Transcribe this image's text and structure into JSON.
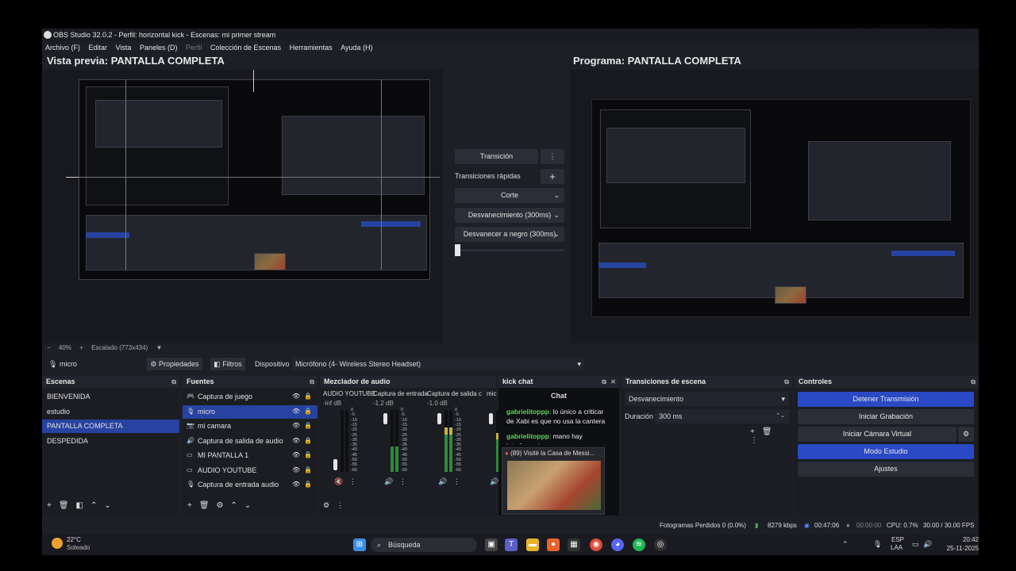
{
  "window": {
    "title": "OBS Studio 32.0.2 - Perfil: horizontal kick - Escenas: mi primer stream",
    "menu": [
      "Archivo (F)",
      "Editar",
      "Vista",
      "Paneles (D)",
      "Perfil",
      "Colección de Escenas",
      "Herramientas",
      "Ayuda (H)"
    ]
  },
  "preview": {
    "label": "Vista previa: PANTALLA COMPLETA",
    "zoom": "40%",
    "scale": "Escalado (773x434)"
  },
  "program": {
    "label": "Programa: PANTALLA COMPLETA"
  },
  "transitions_center": {
    "transition_button": "Transición",
    "quick_label": "Transiciones rápidas",
    "items": [
      "Corte",
      "Desvanecimiento (300ms)",
      "Desvanecer a negro (300ms)"
    ]
  },
  "props_bar": {
    "source": "micro",
    "properties": "Propiedades",
    "filters": "Filtros",
    "device_label": "Dispositivo",
    "device_value": "Micrófono (4- Wireless Stereo Headset)"
  },
  "scenes": {
    "title": "Escenas",
    "items": [
      "BIENVENIDA",
      "estudio",
      "PANTALLA COMPLETA",
      "DESPEDIDA"
    ],
    "selected": 2
  },
  "sources": {
    "title": "Fuentes",
    "items": [
      {
        "label": "Captura de juego",
        "icon": "gamepad-icon"
      },
      {
        "label": "micro",
        "icon": "microphone-icon"
      },
      {
        "label": "mi camara",
        "icon": "camera-icon"
      },
      {
        "label": "Captura de salida de audio",
        "icon": "speaker-icon"
      },
      {
        "label": "MI PANTALLA 1",
        "icon": "monitor-icon"
      },
      {
        "label": "AUDIO YOUTUBE",
        "icon": "monitor-icon"
      },
      {
        "label": "Captura de entrada audio",
        "icon": "microphone-icon"
      }
    ],
    "selected": 1
  },
  "mixer": {
    "title": "Mezclador de audio",
    "channels": [
      {
        "name": "AUDIO YOUTUBE",
        "db": "-inf dB",
        "level": 0.0
      },
      {
        "name": "Captura de entrada",
        "db": "-1.2 dB",
        "level": 0.55
      },
      {
        "name": "Captura de salida c",
        "db": "-1.0 dB",
        "level": 0.8
      },
      {
        "name": "mic",
        "db": "",
        "level": 0.7
      }
    ],
    "scale": [
      "0",
      "-5",
      "-10",
      "-15",
      "-20",
      "-25",
      "-30",
      "-35",
      "-40",
      "-45",
      "-50",
      "-55",
      "-60"
    ]
  },
  "chat": {
    "title": "kick chat",
    "header": "Chat",
    "messages": [
      {
        "user": "gabrielitoppp",
        "text": "lo único a criticar de Xabi es que no usa la cantera"
      },
      {
        "user": "gabrielitoppp",
        "text": "mano hay interferencia"
      }
    ],
    "popup": "(89) Visité la Casa de Messi..."
  },
  "scene_transitions": {
    "title": "Transiciones de escena",
    "type": "Desvanecimiento",
    "duration_label": "Duración",
    "duration_value": "300 ms"
  },
  "controls": {
    "title": "Controles",
    "buttons": [
      "Detener Transmisión",
      "Iniciar Grabación",
      "Iniciar Cámara Virtual",
      "Modo Estudio",
      "Ajustes"
    ]
  },
  "statusbar": {
    "dropped": "Fotogramas Perdidos 0 (0.0%)",
    "bitrate": "8279 kbps",
    "live_time": "00:47:06",
    "rec_time": "00:00:00",
    "cpu": "CPU: 0.7%",
    "fps": "30.00 / 30.00 FPS"
  },
  "taskbar": {
    "temp": "22°C",
    "weather": "Soleado",
    "search": "Búsqueda",
    "lang1": "ESP",
    "lang2": "LAA",
    "time": "20:42",
    "date": "25-11-2025"
  },
  "colors": {
    "accent": "#2742a0",
    "button_blue": "#2a49c4",
    "chat_user": "#58d95b"
  }
}
